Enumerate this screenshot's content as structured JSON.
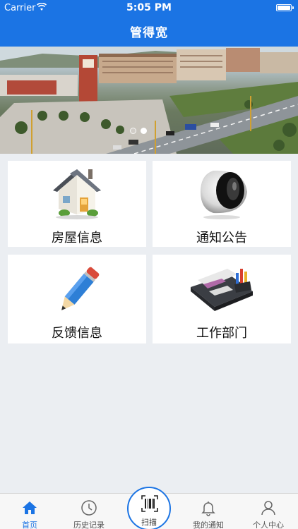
{
  "status_bar": {
    "carrier": "Carrier",
    "time": "5:05 PM"
  },
  "nav": {
    "title": "管得宽"
  },
  "banner": {
    "slide_count": 2,
    "active_slide": 2
  },
  "tiles": [
    {
      "label": "房屋信息",
      "icon": "house-icon"
    },
    {
      "label": "通知公告",
      "icon": "speaker-icon"
    },
    {
      "label": "反馈信息",
      "icon": "pencil-icon"
    },
    {
      "label": "工作部门",
      "icon": "desk-organizer-icon"
    }
  ],
  "tabbar": {
    "home": "首页",
    "history": "历史记录",
    "scan": "扫描",
    "notifications": "我的通知",
    "profile": "个人中心",
    "active": "home"
  },
  "colors": {
    "brand": "#1b74e4",
    "background": "#ebeef2",
    "tile": "#ffffff"
  }
}
